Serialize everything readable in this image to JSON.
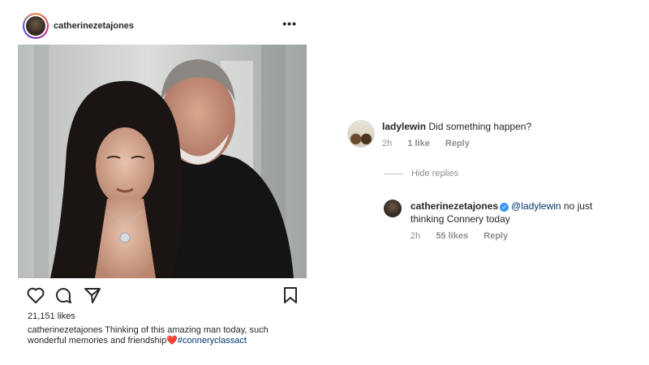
{
  "post": {
    "username": "catherinezetajones",
    "more_label": "•••",
    "likes": "21,151 likes",
    "caption": {
      "username": "catherinezetajones",
      "text": "Thinking of this amazing man today, such wonderful memories and friendship",
      "emoji": "❤️",
      "hashtag": "#conneryclassact"
    }
  },
  "icons": {
    "like": "heart-icon",
    "comment": "comment-icon",
    "share": "share-icon",
    "save": "bookmark-icon",
    "more": "more-options-icon"
  },
  "comments": [
    {
      "username": "ladylewin",
      "text": "Did something happen?",
      "time": "2h",
      "likes": "1 like",
      "reply_label": "Reply"
    }
  ],
  "hide_replies_label": "Hide replies",
  "replies": [
    {
      "username": "catherinezetajones",
      "verified": true,
      "mention": "@ladylewin",
      "text_line1": " no just",
      "text_line2": "thinking Connery today",
      "time": "2h",
      "likes": "55 likes",
      "reply_label": "Reply"
    }
  ],
  "colors": {
    "text": "#262626",
    "muted": "#8e8e8e",
    "link": "#00376b",
    "verified": "#3897f0",
    "heart": "#e0245e"
  }
}
